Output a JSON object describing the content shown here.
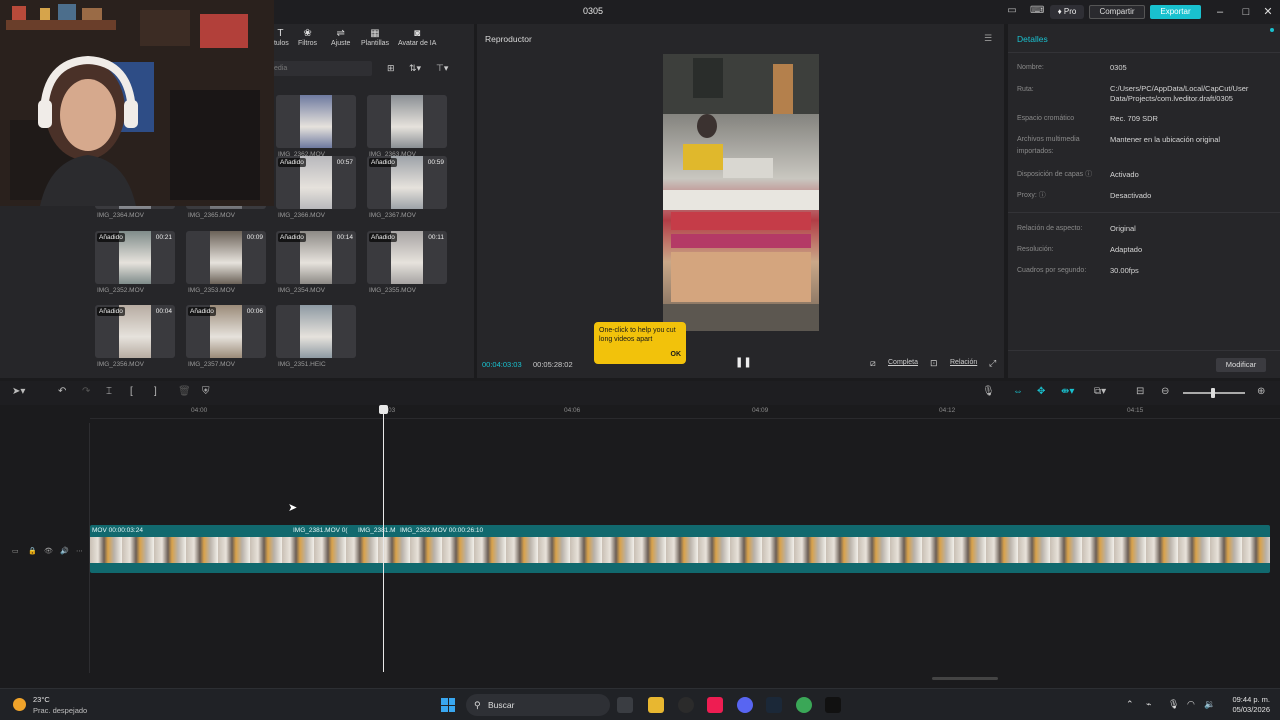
{
  "window": {
    "title": "0305"
  },
  "titlebar": {
    "pro": "♦ Pro",
    "compartir": "Compartir",
    "exportar": "Exportar"
  },
  "media": {
    "tabs": [
      {
        "label": "ítulos",
        "icon": "text-icon"
      },
      {
        "label": "Filtros",
        "icon": "filter-icon"
      },
      {
        "label": "Ajuste",
        "icon": "adjust-icon"
      },
      {
        "label": "Plantillas",
        "icon": "template-icon"
      },
      {
        "label": "Avatar de IA",
        "icon": "avatar-icon"
      }
    ],
    "search_placeholder": "edia",
    "clips": [
      {
        "name": "IMG_2362.MOV",
        "badge": "",
        "dur": ""
      },
      {
        "name": "IMG_2363.MOV",
        "badge": "",
        "dur": ""
      },
      {
        "name": "IMG_2364.MOV",
        "badge": "",
        "dur": ""
      },
      {
        "name": "IMG_2365.MOV",
        "badge": "",
        "dur": ""
      },
      {
        "name": "IMG_2366.MOV",
        "badge": "Añadido",
        "dur": "00:57"
      },
      {
        "name": "IMG_2367.MOV",
        "badge": "Añadido",
        "dur": "00:59"
      },
      {
        "name": "IMG_2352.MOV",
        "badge": "Añadido",
        "dur": "00:21"
      },
      {
        "name": "IMG_2353.MOV",
        "badge": "",
        "dur": "00:09"
      },
      {
        "name": "IMG_2354.MOV",
        "badge": "Añadido",
        "dur": "00:14"
      },
      {
        "name": "IMG_2355.MOV",
        "badge": "Añadido",
        "dur": "00:11"
      },
      {
        "name": "IMG_2356.MOV",
        "badge": "Añadido",
        "dur": "00:04"
      },
      {
        "name": "IMG_2357.MOV",
        "badge": "Añadido",
        "dur": "00:06"
      },
      {
        "name": "IMG_2351.HEIC",
        "badge": "",
        "dur": ""
      }
    ]
  },
  "player": {
    "title": "Reproductor",
    "tooltip": "One-click to help you cut long videos apart",
    "tooltip_ok": "OK",
    "time_current": "00:04:03:03",
    "time_total": "00:05:28:02",
    "completa": "Completa",
    "relacion": "Relación"
  },
  "details": {
    "title": "Detalles",
    "rows": [
      {
        "label": "Nombre:",
        "value": "0305"
      },
      {
        "label": "Ruta:",
        "value": "C:/Users/PC/AppData/Local/CapCut/User Data/Projects/com.lveditor.draft/0305"
      },
      {
        "label": "Espacio cromático",
        "value": "Rec. 709 SDR"
      },
      {
        "label": "Archivos multimedia importados:",
        "value": "Mantener en la ubicación original"
      },
      {
        "label": "Disposición de capas ⓘ",
        "value": "Activado"
      },
      {
        "label": "Proxy: ⓘ",
        "value": "Desactivado"
      },
      {
        "label": "Relación de aspecto:",
        "value": "Original"
      },
      {
        "label": "Resolución:",
        "value": "Adaptado"
      },
      {
        "label": "Cuadros por segundo:",
        "value": "30.00fps"
      }
    ],
    "modificar": "Modificar"
  },
  "timeline": {
    "ticks": [
      "04:00",
      "03",
      "04:06",
      "04:09",
      "04:12",
      "04:15"
    ],
    "clip_labels": [
      "MOV  00:00:03:24",
      "IMG_2381.MOV  0(",
      "IMG_2381.M",
      "IMG_2382.MOV  00:00:26:10"
    ]
  },
  "taskbar": {
    "temp": "23°C",
    "weather": "Prac. despejado",
    "search": "Buscar",
    "time": "09:44 p. m.",
    "date": "05/03/2026"
  },
  "colors": {
    "accent": "#19c1cf",
    "tooltip": "#f2c20b",
    "track": "#11696e"
  }
}
